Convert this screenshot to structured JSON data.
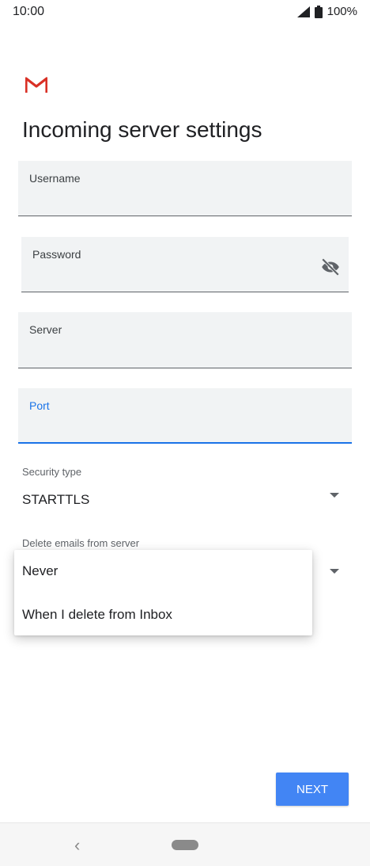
{
  "status_bar": {
    "time": "10:00",
    "battery": "100%"
  },
  "app": {
    "logo_icon": "gmail-logo-icon"
  },
  "page": {
    "title": "Incoming server settings"
  },
  "fields": {
    "username": {
      "label": "Username",
      "value": ""
    },
    "password": {
      "label": "Password",
      "value": ""
    },
    "server": {
      "label": "Server",
      "value": ""
    },
    "port": {
      "label": "Port",
      "value": ""
    }
  },
  "security_type": {
    "label": "Security type",
    "value": "STARTTLS"
  },
  "delete_emails": {
    "label": "Delete emails from server"
  },
  "menu": {
    "options": [
      "Never",
      "When I delete from Inbox"
    ]
  },
  "actions": {
    "next_label": "NEXT"
  },
  "colors": {
    "accent": "#1a73e8",
    "button": "#4285f4",
    "field_bg": "#f1f3f4"
  }
}
